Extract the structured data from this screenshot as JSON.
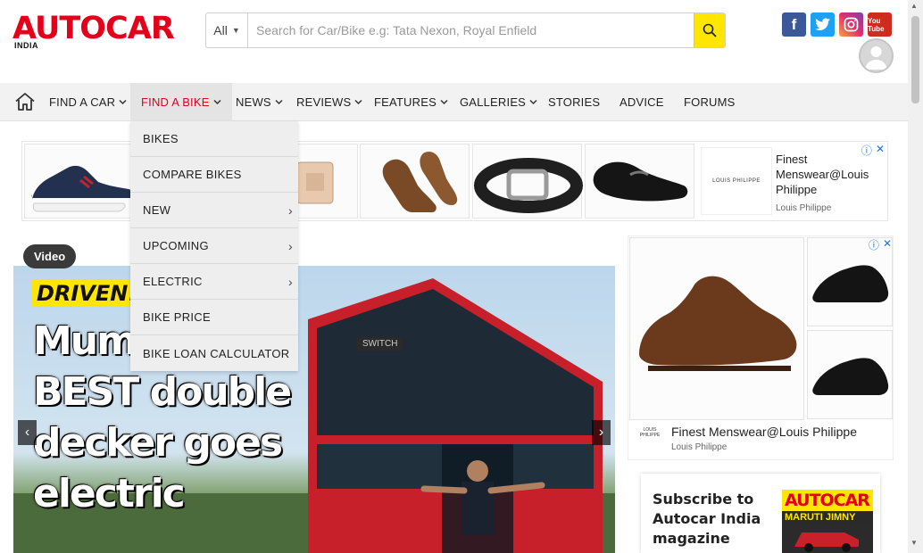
{
  "header": {
    "logo_text": "AUTOCAR",
    "logo_sub": "INDIA",
    "search": {
      "category": "All",
      "placeholder": "Search for Car/Bike e.g: Tata Nexon, Royal Enfield"
    },
    "socials": [
      "facebook-icon",
      "twitter-icon",
      "instagram-icon",
      "youtube-icon"
    ],
    "youtube_label": "You Tube"
  },
  "nav": {
    "items": [
      {
        "label": "FIND A CAR",
        "dropdown": true
      },
      {
        "label": "FIND A BIKE",
        "dropdown": true,
        "active": true
      },
      {
        "label": "NEWS",
        "dropdown": true
      },
      {
        "label": "REVIEWS",
        "dropdown": true
      },
      {
        "label": "FEATURES",
        "dropdown": true
      },
      {
        "label": "GALLERIES",
        "dropdown": true
      },
      {
        "label": "STORIES",
        "dropdown": false
      },
      {
        "label": "ADVICE",
        "dropdown": false
      },
      {
        "label": "FORUMS",
        "dropdown": false
      }
    ],
    "active_color": "#e2001a"
  },
  "bike_menu": [
    {
      "label": "BIKES",
      "submenu": false
    },
    {
      "label": "COMPARE BIKES",
      "submenu": false
    },
    {
      "label": "NEW",
      "submenu": true
    },
    {
      "label": "UPCOMING",
      "submenu": true
    },
    {
      "label": "ELECTRIC",
      "submenu": true
    },
    {
      "label": "BIKE PRICE",
      "submenu": false
    },
    {
      "label": "BIKE LOAN CALCULATOR",
      "submenu": false
    }
  ],
  "ad_top": {
    "brand_logo": "LOUIS PHILIPPE",
    "headline": "Finest Menswear@Louis Philippe",
    "advertiser": "Louis Philippe"
  },
  "hero": {
    "badge": "Video",
    "tag": "DRIVEN!",
    "title": "Mumbai's BEST double decker goes electric",
    "bus_destination": "SWITCH"
  },
  "ad_right": {
    "brand_logo": "LOUIS PHILIPPE",
    "headline": "Finest Menswear@Louis Philippe",
    "advertiser": "Louis Philippe"
  },
  "subscribe": {
    "title": "Subscribe to Autocar India magazine",
    "mag_logo": "AUTOCAR",
    "mag_line_1": "MARUTI",
    "mag_line_2": "JIMNY"
  }
}
